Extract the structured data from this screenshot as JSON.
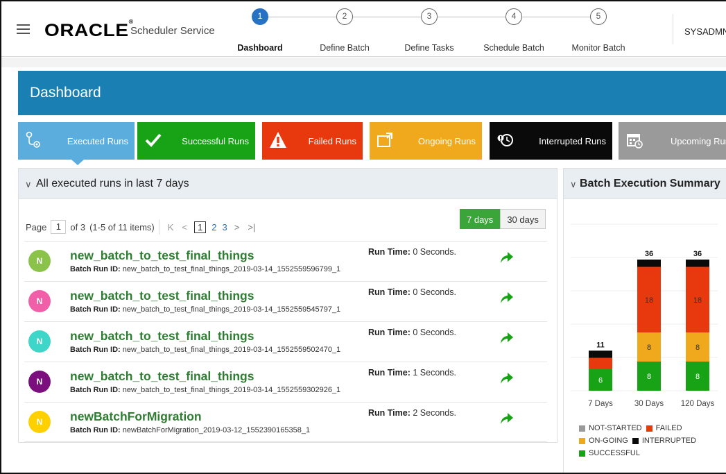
{
  "header": {
    "logo": "ORACLE",
    "service": "Scheduler Service",
    "user": "SYSADMN",
    "steps": [
      {
        "num": "1",
        "label": "Dashboard",
        "active": true
      },
      {
        "num": "2",
        "label": "Define Batch",
        "active": false
      },
      {
        "num": "3",
        "label": "Define Tasks",
        "active": false
      },
      {
        "num": "4",
        "label": "Schedule Batch",
        "active": false
      },
      {
        "num": "5",
        "label": "Monitor Batch",
        "active": false
      }
    ]
  },
  "banner": {
    "title": "Dashboard"
  },
  "tiles": [
    {
      "label": "Executed Runs",
      "color": "#5badde",
      "icon": "executed-runs-icon"
    },
    {
      "label": "Successful Runs",
      "color": "#18a317",
      "icon": "checkmark-icon"
    },
    {
      "label": "Failed Runs",
      "color": "#e8380d",
      "icon": "warning-icon"
    },
    {
      "label": "Ongoing Runs",
      "color": "#f0a81c",
      "icon": "ongoing-icon"
    },
    {
      "label": "Interrupted Runs",
      "color": "#0a0a0a",
      "icon": "interrupted-icon"
    },
    {
      "label": "Upcoming Runs",
      "color": "#9a9a9a",
      "icon": "calendar-icon"
    }
  ],
  "runs_panel": {
    "title": "All executed runs in last 7 days",
    "pager": {
      "page_label": "Page",
      "page": "1",
      "of": "of 3",
      "items": "(1-5 of 11 items)",
      "pages": [
        "1",
        "2",
        "3"
      ]
    },
    "day_buttons": [
      "7 days",
      "30 days"
    ],
    "id_label": "Batch Run ID:",
    "time_label": "Run Time:",
    "runs": [
      {
        "initial": "N",
        "color": "#8bc34a",
        "name": "new_batch_to_test_final_things",
        "run_id": "new_batch_to_test_final_things_2019-03-14_1552559596799_1",
        "run_time": "0 Seconds."
      },
      {
        "initial": "N",
        "color": "#f05fa8",
        "name": "new_batch_to_test_final_things",
        "run_id": "new_batch_to_test_final_things_2019-03-14_1552559545797_1",
        "run_time": "0 Seconds."
      },
      {
        "initial": "N",
        "color": "#3dd6c8",
        "name": "new_batch_to_test_final_things",
        "run_id": "new_batch_to_test_final_things_2019-03-14_1552559502470_1",
        "run_time": "0 Seconds."
      },
      {
        "initial": "N",
        "color": "#7b0f7e",
        "name": "new_batch_to_test_final_things",
        "run_id": "new_batch_to_test_final_things_2019-03-14_1552559302926_1",
        "run_time": "1 Seconds."
      },
      {
        "initial": "N",
        "color": "#ffd000",
        "name": "newBatchForMigration",
        "run_id": "newBatchForMigration_2019-03-12_1552390165358_1",
        "run_time": "2 Seconds."
      }
    ]
  },
  "summary_panel": {
    "title": "Batch Execution Summary"
  },
  "chart_data": {
    "type": "bar",
    "stacked": true,
    "categories": [
      "7 Days",
      "30 Days",
      "120 Days"
    ],
    "totals": [
      "11",
      "36",
      "36"
    ],
    "ymax": 40,
    "series": [
      {
        "name": "SUCCESSFUL",
        "color": "#18a317",
        "values": [
          6,
          8,
          8
        ],
        "labels": [
          "6",
          "8",
          "8"
        ]
      },
      {
        "name": "ON-GOING",
        "color": "#f0a81c",
        "values": [
          0,
          8,
          8
        ],
        "labels": [
          "",
          "8",
          "8"
        ]
      },
      {
        "name": "FAILED",
        "color": "#e8380d",
        "values": [
          3,
          18,
          18
        ],
        "labels": [
          "",
          "18",
          "18"
        ]
      },
      {
        "name": "INTERRUPTED",
        "color": "#0a0a0a",
        "values": [
          2,
          2,
          2
        ],
        "labels": [
          "",
          "",
          ""
        ]
      },
      {
        "name": "NOT-STARTED",
        "color": "#9a9a9a",
        "values": [
          0,
          0,
          0
        ],
        "labels": [
          "",
          "",
          ""
        ]
      }
    ],
    "legend_order": [
      "NOT-STARTED",
      "FAILED",
      "ON-GOING",
      "INTERRUPTED",
      "SUCCESSFUL"
    ]
  }
}
